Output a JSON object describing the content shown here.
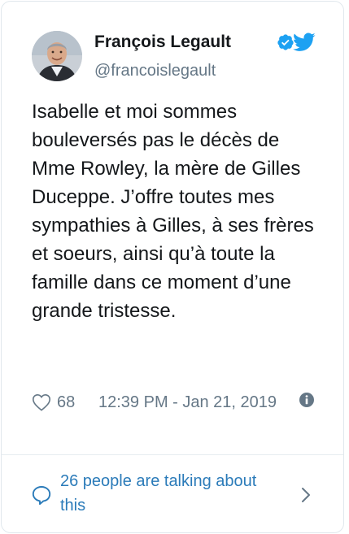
{
  "author": {
    "name": "François Legault",
    "handle": "@francoislegault",
    "verified_icon": "verified-badge-icon",
    "platform_icon": "twitter-bird-icon"
  },
  "tweet": {
    "text": "Isabelle et moi sommes bouleversés pas le décès de Mme Rowley, la mère de Gilles Duceppe. J’offre toutes mes sympathies à Gilles, à ses frères et soeurs, ainsi qu’à toute la famille dans ce moment d’une grande tristesse.",
    "like_count": "68",
    "timestamp": "12:39 PM - Jan 21, 2019"
  },
  "footer": {
    "talking_label": "26 people are talking about this"
  },
  "colors": {
    "accent": "#1da1f2",
    "link": "#2b7bb9",
    "muted": "#657786",
    "text": "#14171a",
    "border": "#e1e8ed"
  }
}
